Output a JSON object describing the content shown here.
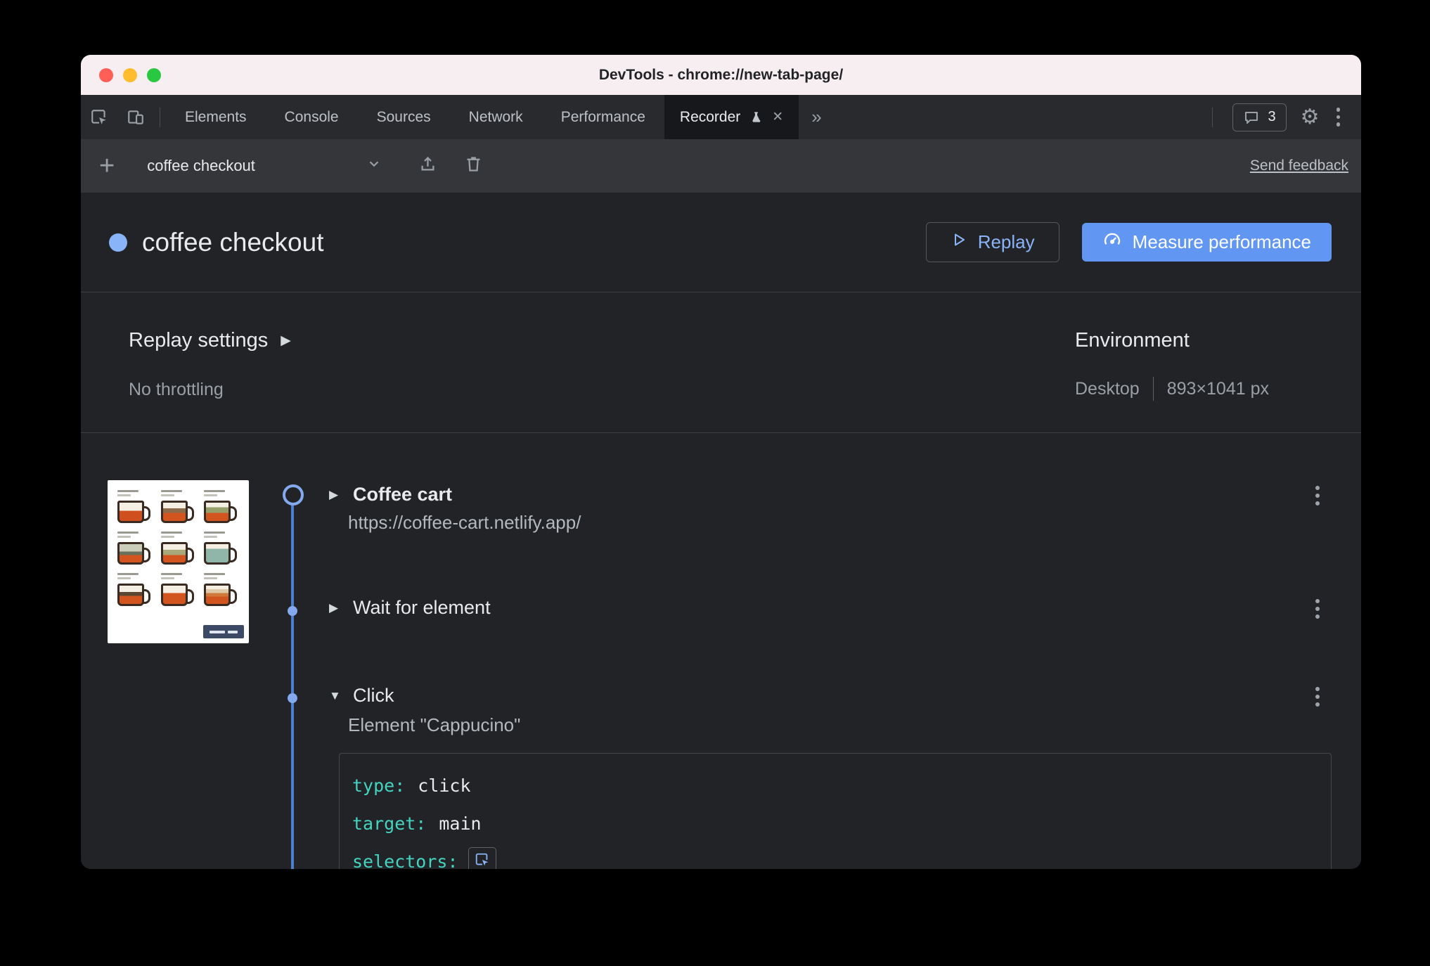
{
  "window": {
    "title": "DevTools - chrome://new-tab-page/"
  },
  "tabbar": {
    "tabs": [
      {
        "label": "Elements"
      },
      {
        "label": "Console"
      },
      {
        "label": "Sources"
      },
      {
        "label": "Network"
      },
      {
        "label": "Performance"
      }
    ],
    "recorder_tab": {
      "label": "Recorder",
      "close_glyph": "✕"
    },
    "more_tabs_glyph": "»",
    "chat_count": "3",
    "gear_glyph": "⚙"
  },
  "recorder_toolbar": {
    "add_glyph": "+",
    "recording_name": "coffee checkout",
    "send_feedback_label": "Send feedback"
  },
  "header": {
    "title": "coffee checkout",
    "replay_button": "Replay",
    "measure_button": "Measure performance"
  },
  "replay_settings": {
    "label": "Replay settings",
    "arrow": "▶",
    "throttling": "No throttling",
    "environment_label": "Environment",
    "device": "Desktop",
    "viewport": "893×1041 px"
  },
  "steps": [
    {
      "arrow": "▶",
      "title": "Coffee cart",
      "subtitle": "https://coffee-cart.netlify.app/"
    },
    {
      "arrow": "▶",
      "title": "Wait for element",
      "subtitle": ""
    },
    {
      "arrow": "▼",
      "title": "Click",
      "subtitle": "Element \"Cappucino\""
    }
  ],
  "step_code": {
    "lines": [
      {
        "key_label": "type:",
        "value": "click"
      },
      {
        "key_label": "target:",
        "value": "main"
      },
      {
        "key_label": "selectors:",
        "value": ""
      }
    ]
  },
  "colors": {
    "accent_blue": "#8ab4f8",
    "primary_button_bg": "#6197f3",
    "timeline_blue": "#4f7ecb",
    "code_key_teal": "#45d4c0"
  }
}
